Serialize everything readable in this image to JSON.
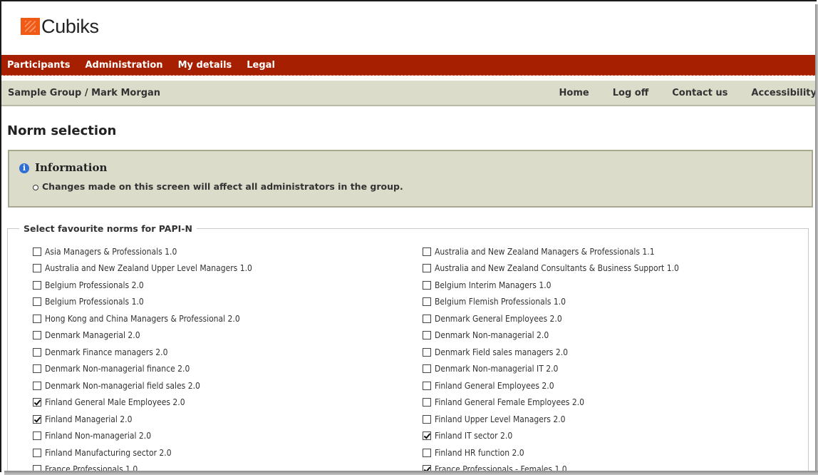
{
  "brand": {
    "name": "Cubiks",
    "color": "#f05a14"
  },
  "nav": {
    "primary": [
      "Participants",
      "Administration",
      "My details",
      "Legal"
    ],
    "breadcrumb": "Sample Group / Mark Morgan",
    "utility": [
      "Home",
      "Log off",
      "Contact us",
      "Accessibility"
    ]
  },
  "page": {
    "title": "Norm selection"
  },
  "info": {
    "title": "Information",
    "message": "Changes made on this screen will affect all administrators in the group."
  },
  "norms": {
    "legend": "Select favourite norms for PAPI-N",
    "left": [
      {
        "label": "Asia Managers & Professionals 1.0",
        "checked": false
      },
      {
        "label": "Australia and New Zealand Upper Level Managers 1.0",
        "checked": false
      },
      {
        "label": "Belgium Professionals 2.0",
        "checked": false
      },
      {
        "label": "Belgium Professionals 1.0",
        "checked": false
      },
      {
        "label": "Hong Kong and China Managers & Professional 2.0",
        "checked": false
      },
      {
        "label": "Denmark Managerial 2.0",
        "checked": false
      },
      {
        "label": "Denmark Finance managers 2.0",
        "checked": false
      },
      {
        "label": "Denmark Non-managerial finance 2.0",
        "checked": false
      },
      {
        "label": "Denmark Non-managerial field sales 2.0",
        "checked": false
      },
      {
        "label": "Finland General Male Employees 2.0",
        "checked": true
      },
      {
        "label": "Finland Managerial 2.0",
        "checked": true
      },
      {
        "label": "Finland Non-managerial 2.0",
        "checked": false
      },
      {
        "label": "Finland Manufacturing sector 2.0",
        "checked": false
      },
      {
        "label": "France Professionals 1.0",
        "checked": false
      }
    ],
    "right": [
      {
        "label": "Australia and New Zealand Managers & Professionals 1.1",
        "checked": false
      },
      {
        "label": "Australia and New Zealand Consultants & Business Support 1.0",
        "checked": false
      },
      {
        "label": "Belgium Interim Managers 1.0",
        "checked": false
      },
      {
        "label": "Belgium Flemish Professionals 1.0",
        "checked": false
      },
      {
        "label": "Denmark General Employees 2.0",
        "checked": false
      },
      {
        "label": "Denmark Non-managerial 2.0",
        "checked": false
      },
      {
        "label": "Denmark Field sales managers 2.0",
        "checked": false
      },
      {
        "label": "Denmark Non-managerial IT 2.0",
        "checked": false
      },
      {
        "label": "Finland General Employees 2.0",
        "checked": false
      },
      {
        "label": "Finland General Female Employees 2.0",
        "checked": false
      },
      {
        "label": "Finland Upper Level Managers 2.0",
        "checked": false
      },
      {
        "label": "Finland IT sector 2.0",
        "checked": true
      },
      {
        "label": "Finland HR function 2.0",
        "checked": false
      },
      {
        "label": "France Professionals - Females 1.0",
        "checked": true
      }
    ]
  },
  "colors": {
    "nav_bar": "#a61f00",
    "sub_bar": "#dcdccb",
    "info_border": "#a9a990",
    "info_icon": "#2f6fd8"
  }
}
